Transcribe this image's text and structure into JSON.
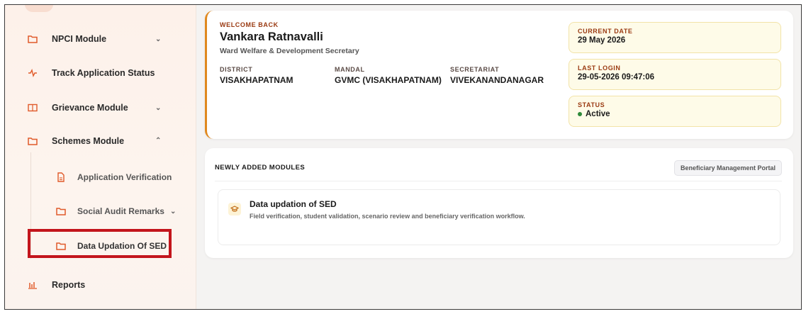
{
  "sidebar": {
    "npci": {
      "label": "NPCI Module",
      "icon": "folder-icon"
    },
    "track": {
      "label": "Track Application Status",
      "icon": "activity-icon"
    },
    "grievance": {
      "label": "Grievance Module",
      "icon": "ticket-icon"
    },
    "schemes": {
      "label": "Schemes Module",
      "icon": "folder-icon"
    },
    "sub_items": {
      "app_verification": "Application Verification",
      "social_audit": "Social Audit Remarks",
      "data_updation": "Data Updation Of SED"
    },
    "reports": {
      "label": "Reports",
      "icon": "bar-chart-icon"
    }
  },
  "welcome": {
    "greeting": "WELCOME BACK",
    "name": "Vankara Ratnavalli",
    "role": "Ward Welfare & Development Secretary",
    "district_label": "DISTRICT",
    "district": "VISAKHAPATNAM",
    "mandal_label": "MANDAL",
    "mandal": "GVMC (VISAKHAPATNAM)",
    "secretariat_label": "SECRETARIAT",
    "secretariat": "VIVEKANANDANAGAR",
    "current_date_label": "CURRENT DATE",
    "current_date": "29 May 2026",
    "last_login_label": "LAST LOGIN",
    "last_login": "29-05-2026 09:47:06",
    "status_label": "STATUS",
    "status": "Active"
  },
  "modules": {
    "heading": "NEWLY ADDED MODULES",
    "portal_button": "Beneficiary Management Portal",
    "item_title": "Data updation of SED",
    "item_desc": "Field verification, student validation, scenario review and beneficiary verification workflow."
  },
  "colors": {
    "accent": "#e05a2a",
    "highlight": "#c3151c",
    "status": "#2e8a3a"
  }
}
